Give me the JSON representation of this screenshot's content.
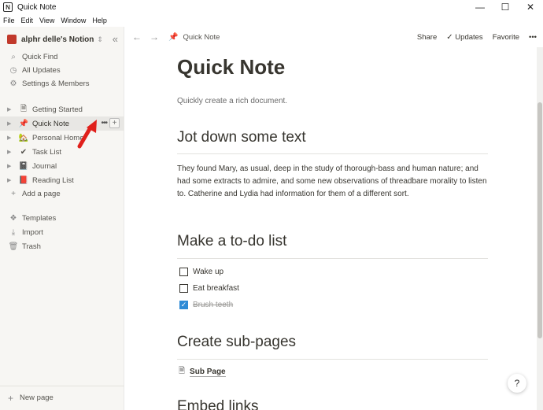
{
  "window": {
    "icon": "N",
    "title": "Quick Note",
    "controls": [
      "—",
      "☐",
      "✕"
    ]
  },
  "menu": [
    "File",
    "Edit",
    "View",
    "Window",
    "Help"
  ],
  "sidebar": {
    "workspace": "alphr delle's Notion",
    "top_items": [
      {
        "icon": "search-icon",
        "glyph": "⌕",
        "label": "Quick Find"
      },
      {
        "icon": "clock-icon",
        "glyph": "◷",
        "label": "All Updates"
      },
      {
        "icon": "gear-icon",
        "glyph": "⚙",
        "label": "Settings & Members"
      }
    ],
    "pages": [
      {
        "icon": "document-icon",
        "glyph": "🗎",
        "label": "Getting Started"
      },
      {
        "icon": "pin-icon",
        "glyph": "📌",
        "label": "Quick Note"
      },
      {
        "icon": "house-icon",
        "glyph": "🏡",
        "label": "Personal Home"
      },
      {
        "icon": "checkmark-icon",
        "glyph": "✔",
        "label": "Task List"
      },
      {
        "icon": "notebook-icon",
        "glyph": "📓",
        "label": "Journal"
      },
      {
        "icon": "book-icon",
        "glyph": "📕",
        "label": "Reading List"
      }
    ],
    "add_page": "Add a page",
    "bottom_items": [
      {
        "icon": "templates-icon",
        "glyph": "❖",
        "label": "Templates"
      },
      {
        "icon": "import-icon",
        "glyph": "⤓",
        "label": "Import"
      },
      {
        "icon": "trash-icon",
        "glyph": "🗑",
        "label": "Trash"
      }
    ],
    "new_page": "New page"
  },
  "topbar": {
    "breadcrumb": "Quick Note",
    "share": "Share",
    "updates": "Updates",
    "favorite": "Favorite",
    "more": "•••"
  },
  "page": {
    "title": "Quick Note",
    "subtitle": "Quickly create a rich document.",
    "h_text": "Jot down some text",
    "paragraph": "They found Mary, as usual, deep in the study of thorough-bass and human nature; and had some extracts to admire, and some new observations of threadbare morality to listen to. Catherine and Lydia had information for them of a different sort.",
    "h_todo": "Make a to-do list",
    "todos": [
      {
        "label": "Wake up",
        "checked": false
      },
      {
        "label": "Eat breakfast",
        "checked": false
      },
      {
        "label": "Brush teeth",
        "checked": true
      }
    ],
    "h_sub": "Create sub-pages",
    "subpage": "Sub Page",
    "h_embed": "Embed links"
  },
  "help": "?"
}
